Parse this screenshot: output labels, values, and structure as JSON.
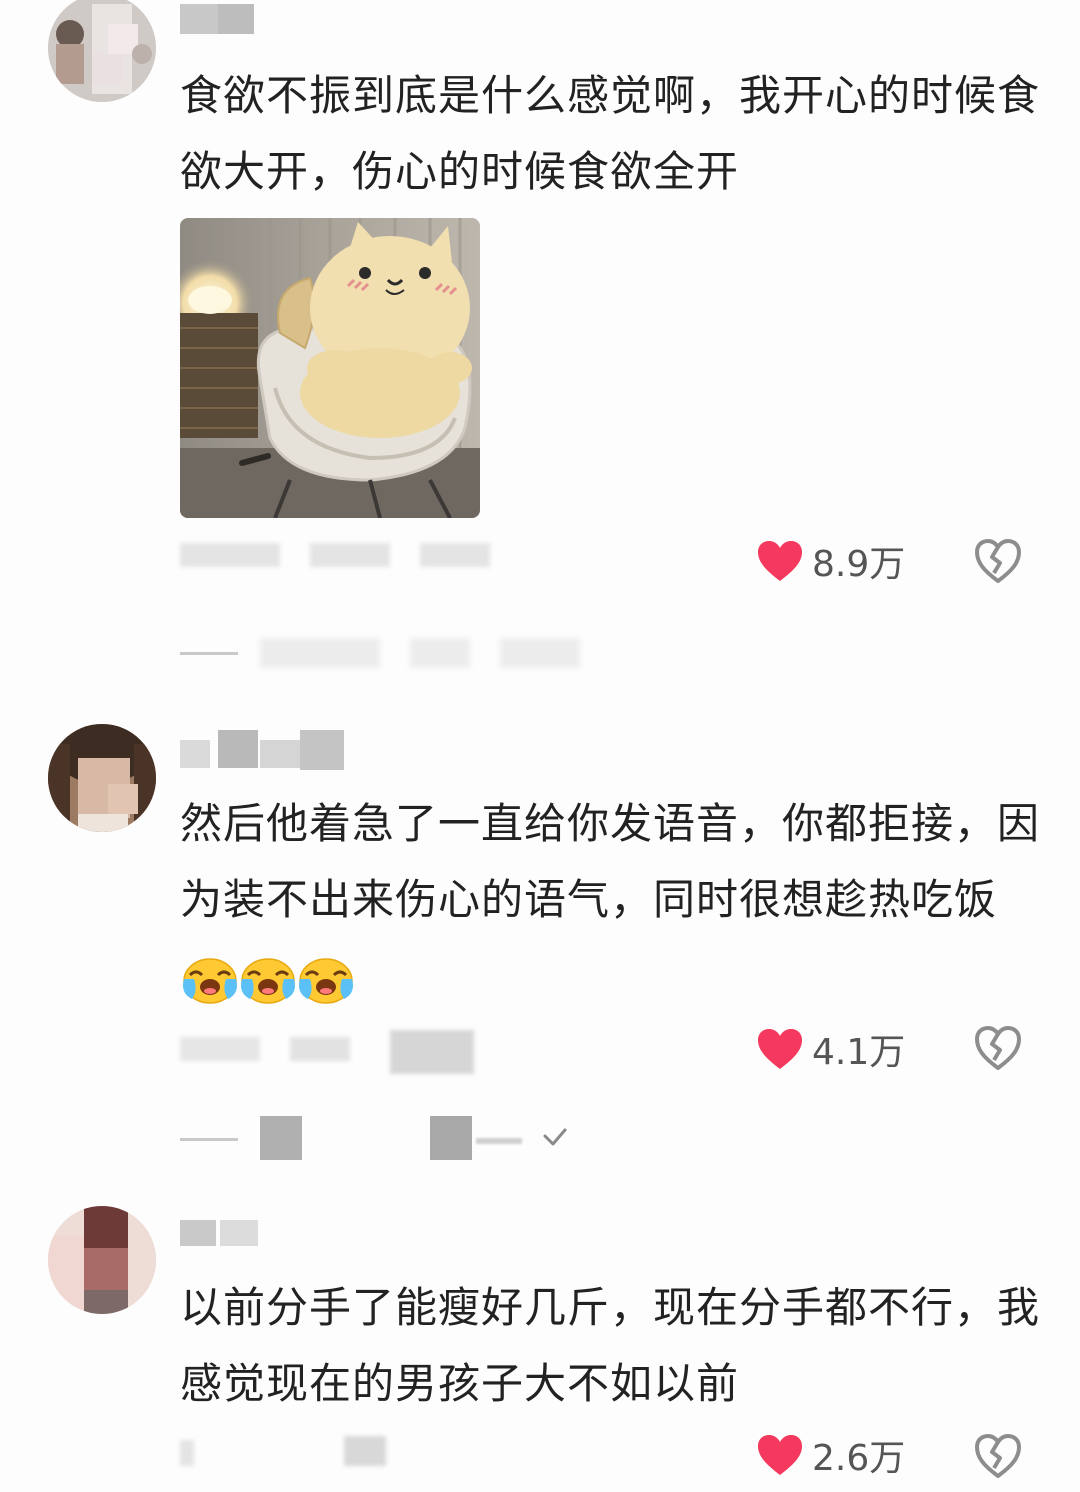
{
  "comments": [
    {
      "id": "c1",
      "text": "食欲不振到底是什么感觉啊，我开心的时候食欲大开，伤心的时候食欲全开",
      "likes": "8.9万",
      "has_image": true
    },
    {
      "id": "c2",
      "text": "然后他着急了一直给你发语音，你都拒接，因为装不出来伤心的语气，同时很想趁热吃饭",
      "emoji": [
        "loudly-crying-face",
        "loudly-crying-face",
        "loudly-crying-face"
      ],
      "likes": "4.1万"
    },
    {
      "id": "c3",
      "text": "以前分手了能瘦好几斤，现在分手都不行，我感觉现在的男孩子大不如以前",
      "likes": "2.6万"
    }
  ],
  "colors": {
    "like_heart": "#f5385e",
    "count_text": "#555555",
    "body_text": "#222222",
    "meta_text": "#bdbdbd",
    "background": "#fdfdfd"
  }
}
